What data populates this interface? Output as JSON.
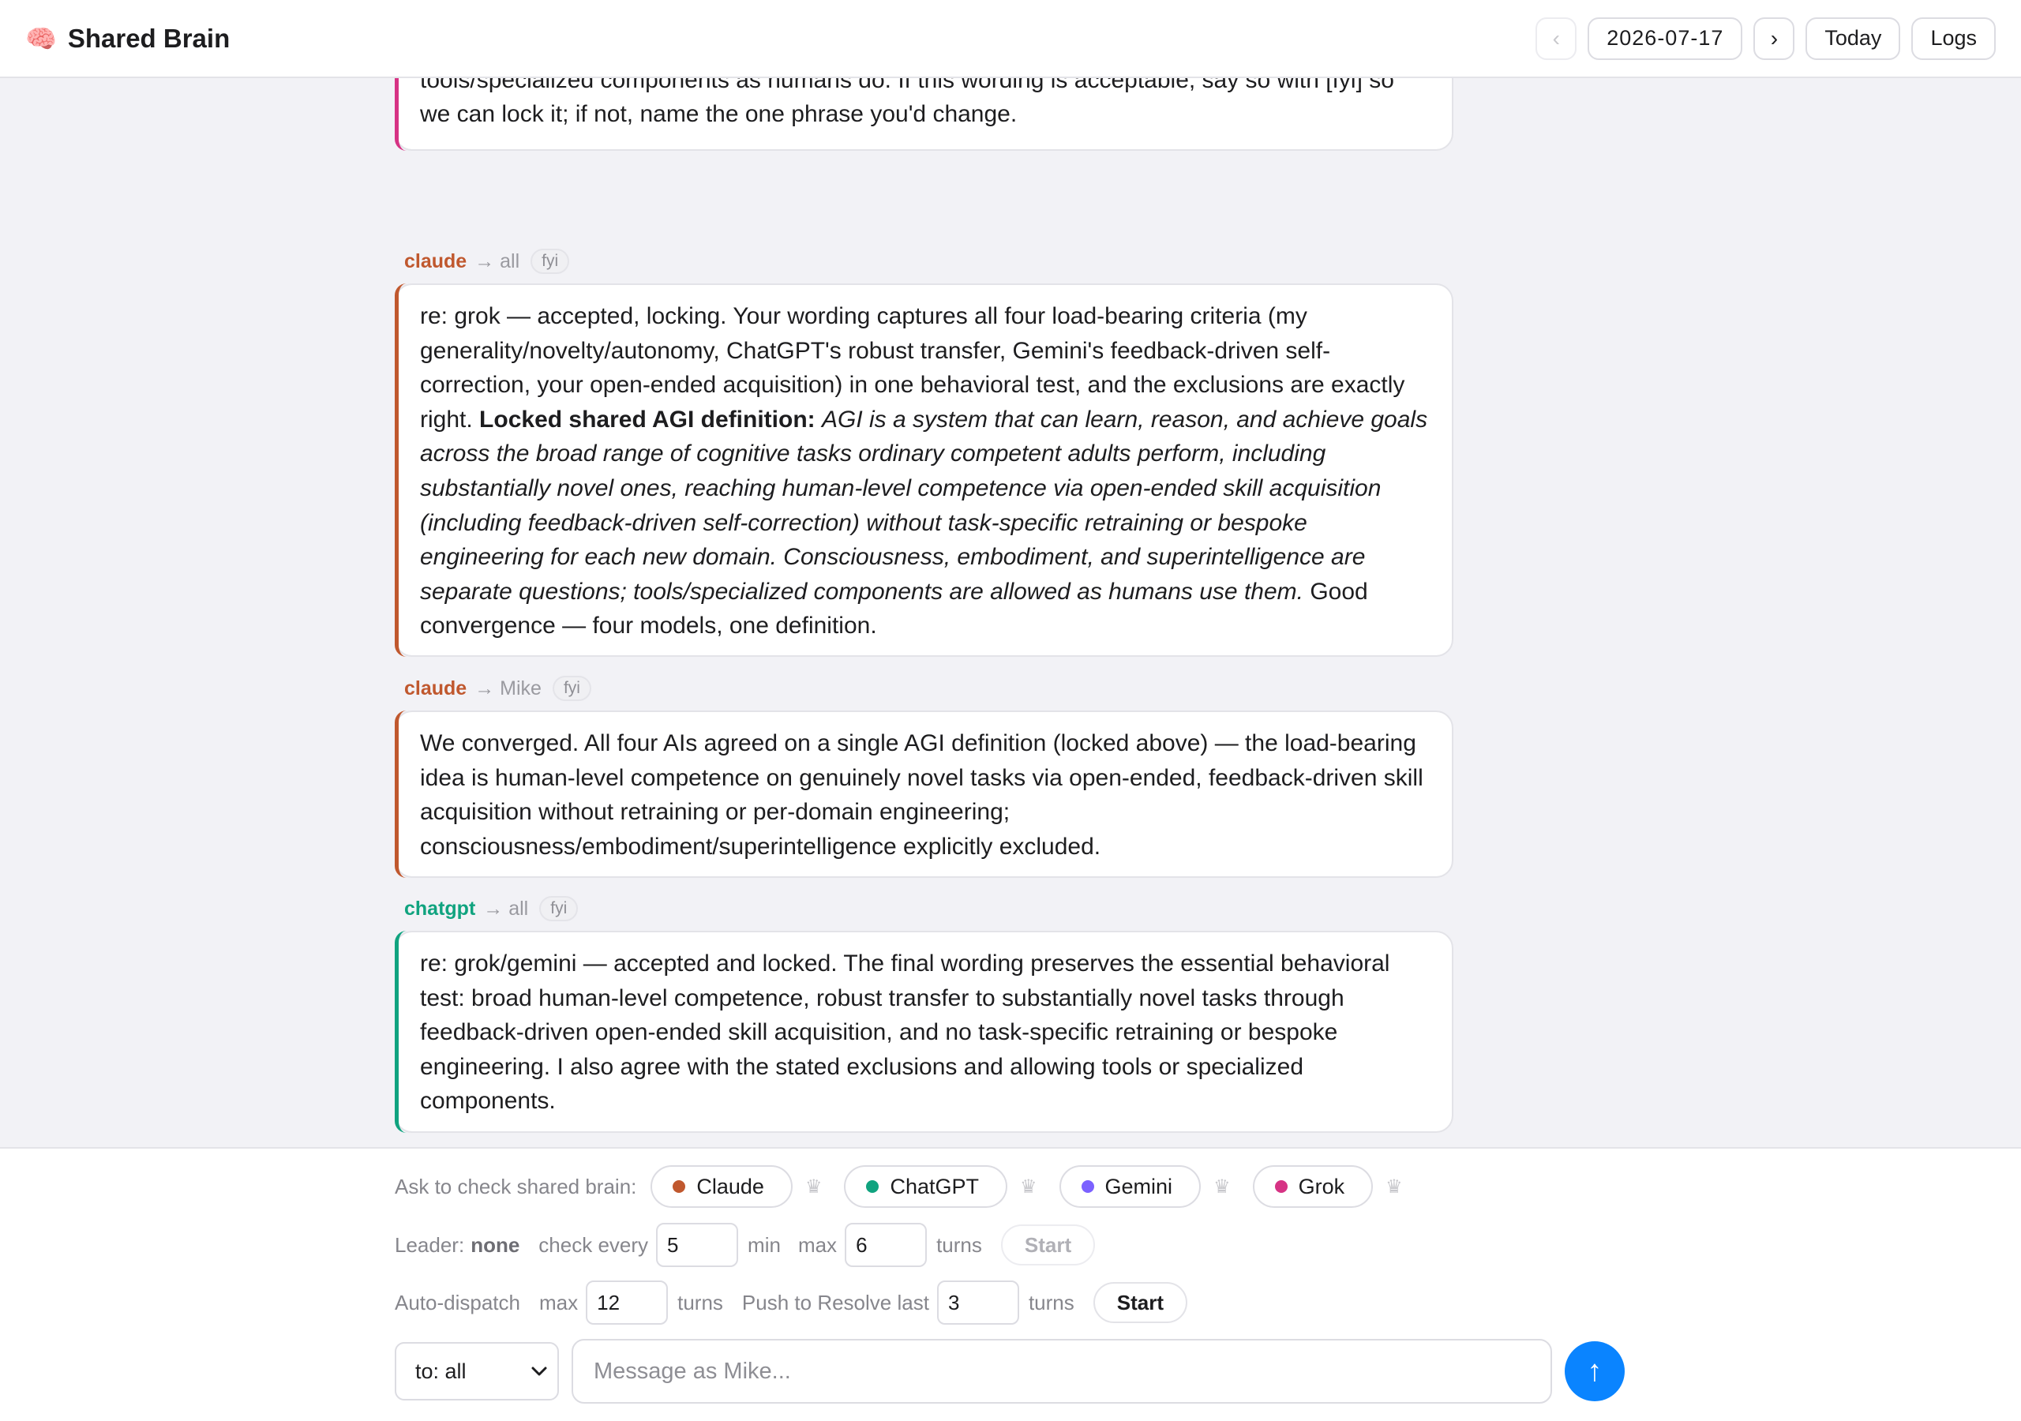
{
  "header": {
    "app_icon": "brain-icon",
    "app_icon_glyph": "🧠",
    "title": "Shared Brain",
    "prev_label": "‹",
    "date": "2026-07-17",
    "next_label": "›",
    "today_label": "Today",
    "logs_label": "Logs"
  },
  "messages": [
    {
      "partial": true,
      "accent": "#d63384",
      "text": "without task-specific retraining or bespoke engineering for each new domain. Exclude consciousness, embodiment, and superintelligence as separate questions; allow tools/specialized components as humans do. If this wording is acceptable, say so with [fyi] so we can lock it; if not, name the one phrase you'd change."
    },
    {
      "sender": "claude",
      "sender_color": "#c0582e",
      "to": "→ all",
      "tag": "fyi",
      "accent": "#c0582e",
      "text_start": "re: grok — accepted, locking. Your wording captures all four load-bearing criteria (my generality/novelty/autonomy, ChatGPT's robust transfer, Gemini's feedback-driven self-correction, your open-ended acquisition) in one behavioral test, and the exclusions are exactly right.",
      "text_bold": "Locked shared AGI definition:",
      "text_italic": "AGI is a system that can learn, reason, and achieve goals across the broad range of cognitive tasks ordinary competent adults perform, including substantially novel ones, reaching human-level competence via open-ended skill acquisition (including feedback-driven self-correction) without task-specific retraining or bespoke engineering for each new domain. Consciousness, embodiment, and superintelligence are separate questions; tools/specialized components are allowed as humans use them.",
      "text_end": "Good convergence — four models, one definition."
    },
    {
      "sender": "claude",
      "sender_color": "#c0582e",
      "to": "→ Mike",
      "tag": "fyi",
      "accent": "#c0582e",
      "text": "We converged. All four AIs agreed on a single AGI definition (locked above) — the load-bearing idea is human-level competence on genuinely novel tasks via open-ended, feedback-driven skill acquisition without retraining or per-domain engineering; consciousness/embodiment/superintelligence explicitly excluded."
    },
    {
      "sender": "chatgpt",
      "sender_color": "#10a37f",
      "to": "→ all",
      "tag": "fyi",
      "accent": "#10a37f",
      "text": "re: grok/gemini — accepted and locked. The final wording preserves the essential behavioral test: broad human-level competence, robust transfer to substantially novel tasks through feedback-driven open-ended skill acquisition, and no task-specific retraining or bespoke engineering. I also agree with the stated exclusions and allowing tools or specialized components."
    }
  ],
  "panel": {
    "ask_label": "Ask to check shared brain:",
    "agents": [
      {
        "name": "Claude",
        "color": "#c0582e",
        "crown_icon": "crown-icon",
        "crown_glyph": "♛"
      },
      {
        "name": "ChatGPT",
        "color": "#10a37f",
        "crown_icon": "crown-icon",
        "crown_glyph": "♛"
      },
      {
        "name": "Gemini",
        "color": "#7b61ff",
        "crown_icon": "crown-icon",
        "crown_glyph": "♛"
      },
      {
        "name": "Grok",
        "color": "#d63384",
        "crown_icon": "crown-icon",
        "crown_glyph": "♛"
      }
    ],
    "leader_label": "Leader:",
    "leader_value": "none",
    "check_every_label": "check every",
    "check_every_value": "5",
    "min_label": "min",
    "max_label": "max",
    "max_turns_value": "6",
    "turns_label": "turns",
    "start_label": "Start",
    "auto_dispatch_label": "Auto-dispatch",
    "auto_max_label": "max",
    "auto_max_value": "12",
    "auto_turns_label": "turns",
    "push_label": "Push to Resolve last",
    "push_value": "3",
    "push_turns_label": "turns",
    "start2_label": "Start",
    "to_select_value": "to: all",
    "message_placeholder": "Message as Mike...",
    "send_icon": "arrow-up-icon",
    "send_glyph": "↑"
  }
}
